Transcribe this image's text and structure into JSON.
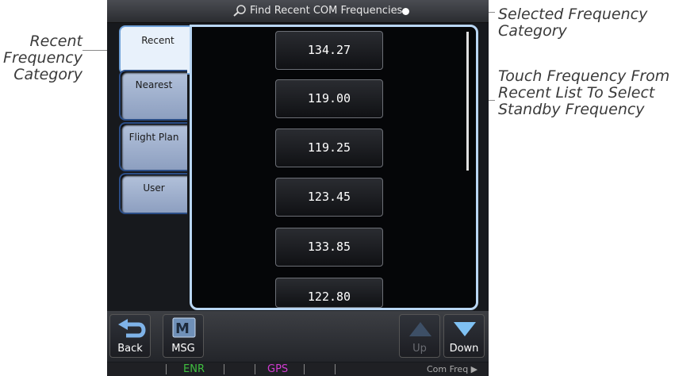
{
  "callouts": {
    "left": [
      "Recent",
      "Frequency",
      "Category"
    ],
    "right1": [
      "Selected Frequency",
      "Category"
    ],
    "right2": [
      "Touch Frequency From",
      "Recent List To Select",
      "Standby Frequency"
    ]
  },
  "titlebar": {
    "title": "Find Recent COM Frequencies",
    "icon": "search-icon"
  },
  "tabs": [
    {
      "label": "Recent",
      "active": true
    },
    {
      "label": "Nearest",
      "active": false
    },
    {
      "label": "Flight Plan",
      "active": false
    },
    {
      "label": "User",
      "active": false
    }
  ],
  "frequencies": [
    "134.27",
    "119.00",
    "119.25",
    "123.45",
    "133.85",
    "122.80"
  ],
  "softkeys": {
    "back": "Back",
    "msg": "MSG",
    "up": "Up",
    "down": "Down"
  },
  "status": {
    "enr": "ENR",
    "gps": "GPS",
    "right": "Com Freq ▶"
  },
  "colors": {
    "enr": "#3fbf3f",
    "gps": "#d13bd1",
    "accent": "#6ea0d8"
  }
}
